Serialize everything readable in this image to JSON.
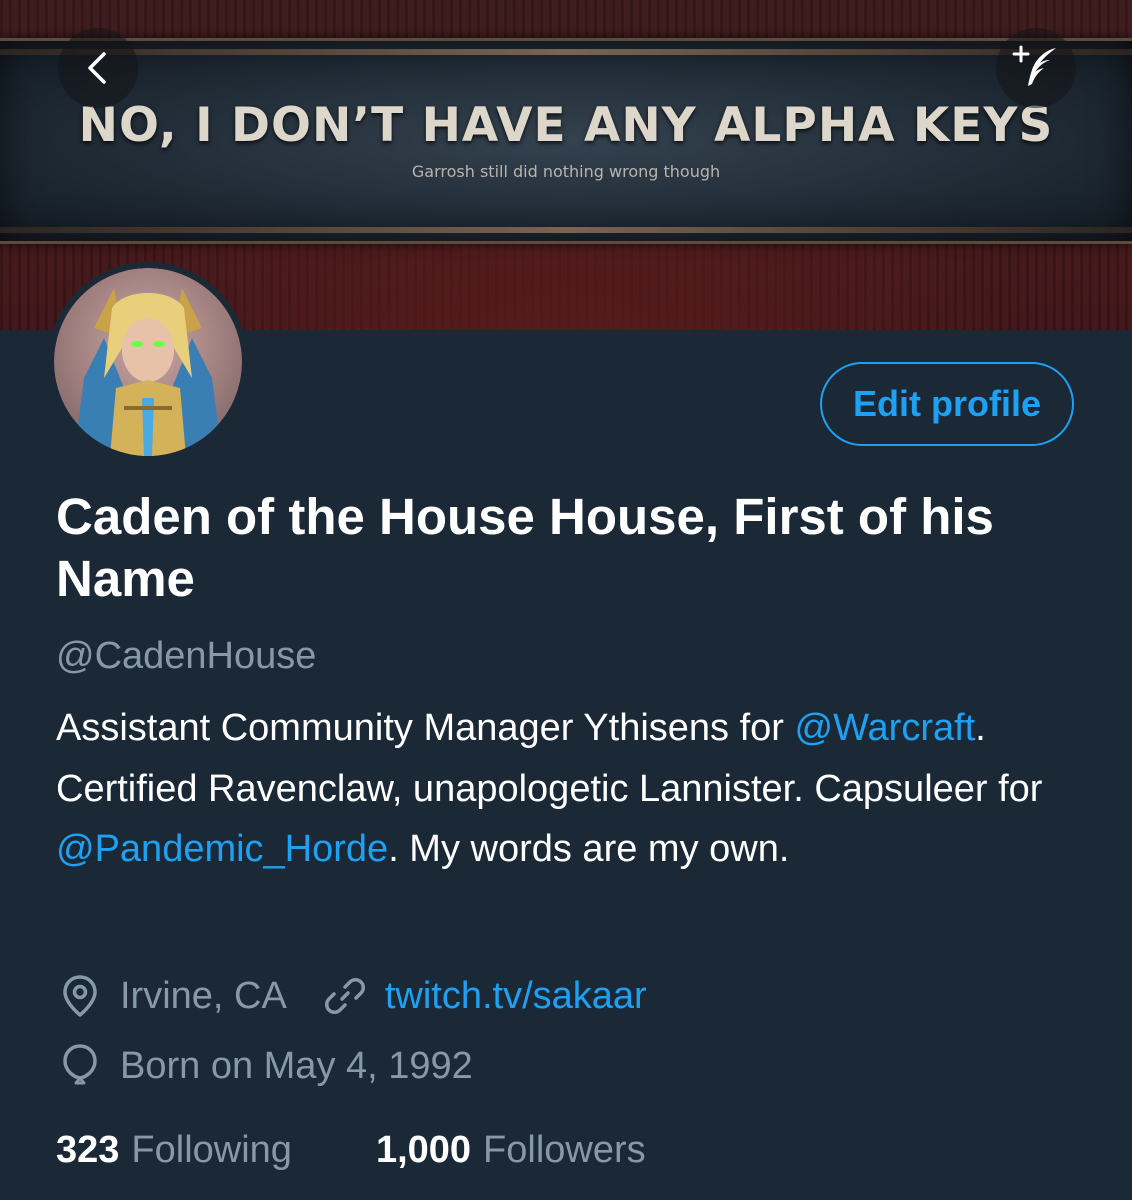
{
  "banner": {
    "headline": "NO, I DON’T HAVE ANY ALPHA KEYS",
    "subtitle": "Garrosh still did nothing wrong though"
  },
  "nav": {
    "back_icon": "chevron-left-icon",
    "compose_icon": "compose-tweet-feather-icon"
  },
  "profile": {
    "edit_button_label": "Edit profile",
    "display_name": "Caden of the House House, First of his Name",
    "handle": "@CadenHouse",
    "bio": {
      "segment_1": "Assistant Community Manager Ythisens for ",
      "mention_1": "@Warcraft",
      "segment_2": ". Certified Ravenclaw, unapologetic Lannister. Capsuleer for ",
      "mention_2": "@Pandemic_Horde",
      "segment_3": ". My words are my own."
    },
    "location": "Irvine, CA",
    "website": "twitch.tv/sakaar",
    "birth": "Born on May 4, 1992",
    "following_count": "323",
    "following_label": "Following",
    "followers_count": "1,000",
    "followers_label": "Followers"
  },
  "colors": {
    "background": "#1b2836",
    "accent": "#1da1f2",
    "secondary_text": "#8899a6",
    "primary_text": "#ffffff"
  }
}
